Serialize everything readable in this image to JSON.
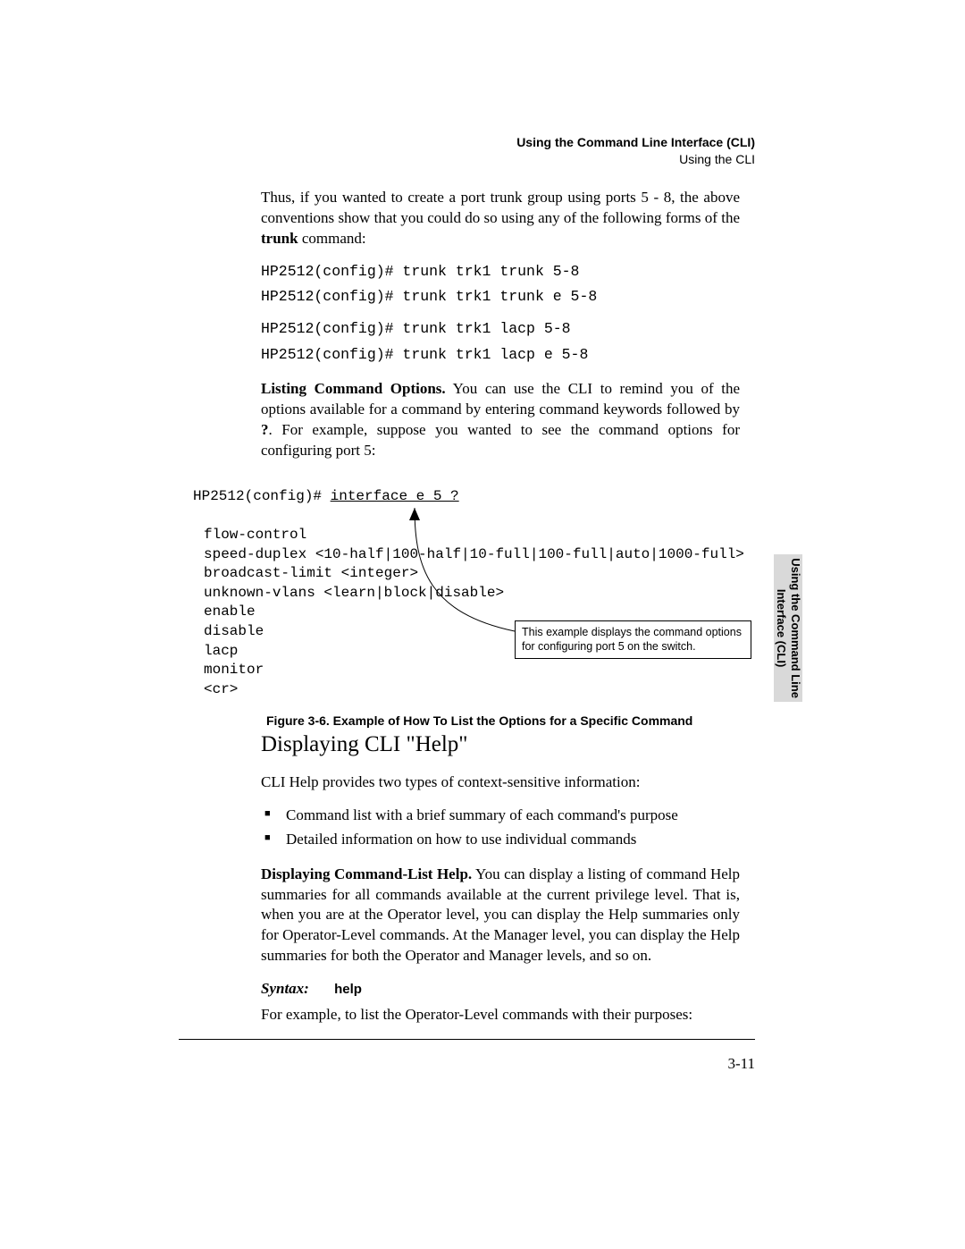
{
  "header": {
    "title": "Using the Command Line Interface (CLI)",
    "subtitle": "Using the CLI"
  },
  "body": {
    "p1_a": "Thus, if you wanted to create a port trunk group using ports 5 - 8, the above conventions show that you could do so using any of the following forms of the ",
    "p1_b": "trunk",
    "p1_c": " command:",
    "cmd1": "HP2512(config)# trunk trk1 trunk 5-8",
    "cmd2": "HP2512(config)# trunk trk1 trunk e 5-8",
    "cmd3": "HP2512(config)# trunk trk1 lacp 5-8",
    "cmd4": "HP2512(config)# trunk trk1 lacp e 5-8",
    "p2_lead": "Listing Command Options.",
    "p2_a": "  You can use the CLI to remind you of the options available for a command by entering command keywords followed by ",
    "p2_b": "?",
    "p2_c": ". For example, suppose you wanted to see the command options for configuring port 5:"
  },
  "figure": {
    "prompt": "HP2512(config)# ",
    "entry": "interface e 5 ?",
    "options": "flow-control\nspeed-duplex <10-half|100-half|10-full|100-full|auto|1000-full>\nbroadcast-limit <integer>\nunknown-vlans <learn|block|disable>\nenable\ndisable\nlacp\nmonitor\n<cr>",
    "callout": "This example displays the command options for configuring port 5 on the switch.",
    "caption": "Figure 3-6.   Example of How To List the Options for a Specific Command"
  },
  "lower": {
    "h2": "Displaying CLI \"Help\"",
    "p1": "CLI Help provides two types of context-sensitive information:",
    "bullets": [
      "Command list with a brief summary of each command's purpose",
      "Detailed information on how to use individual commands"
    ],
    "p2_lead": "Displaying Command-List Help.",
    "p2": "  You can display a listing of command Help summaries for all commands available at the current privilege level. That is, when you are at the Operator level, you can display the Help summaries only for Operator-Level commands. At the Manager level, you can display the Help summaries for both the Operator  and Manager levels, and so on.",
    "syntax_label": "Syntax:",
    "syntax_cmd": "help",
    "p3": "For example, to list the Operator-Level commands with their purposes:"
  },
  "sidetab": {
    "line1": "Using the Command Line",
    "line2": "Interface (CLI)"
  },
  "footer": {
    "page": "3-11"
  }
}
